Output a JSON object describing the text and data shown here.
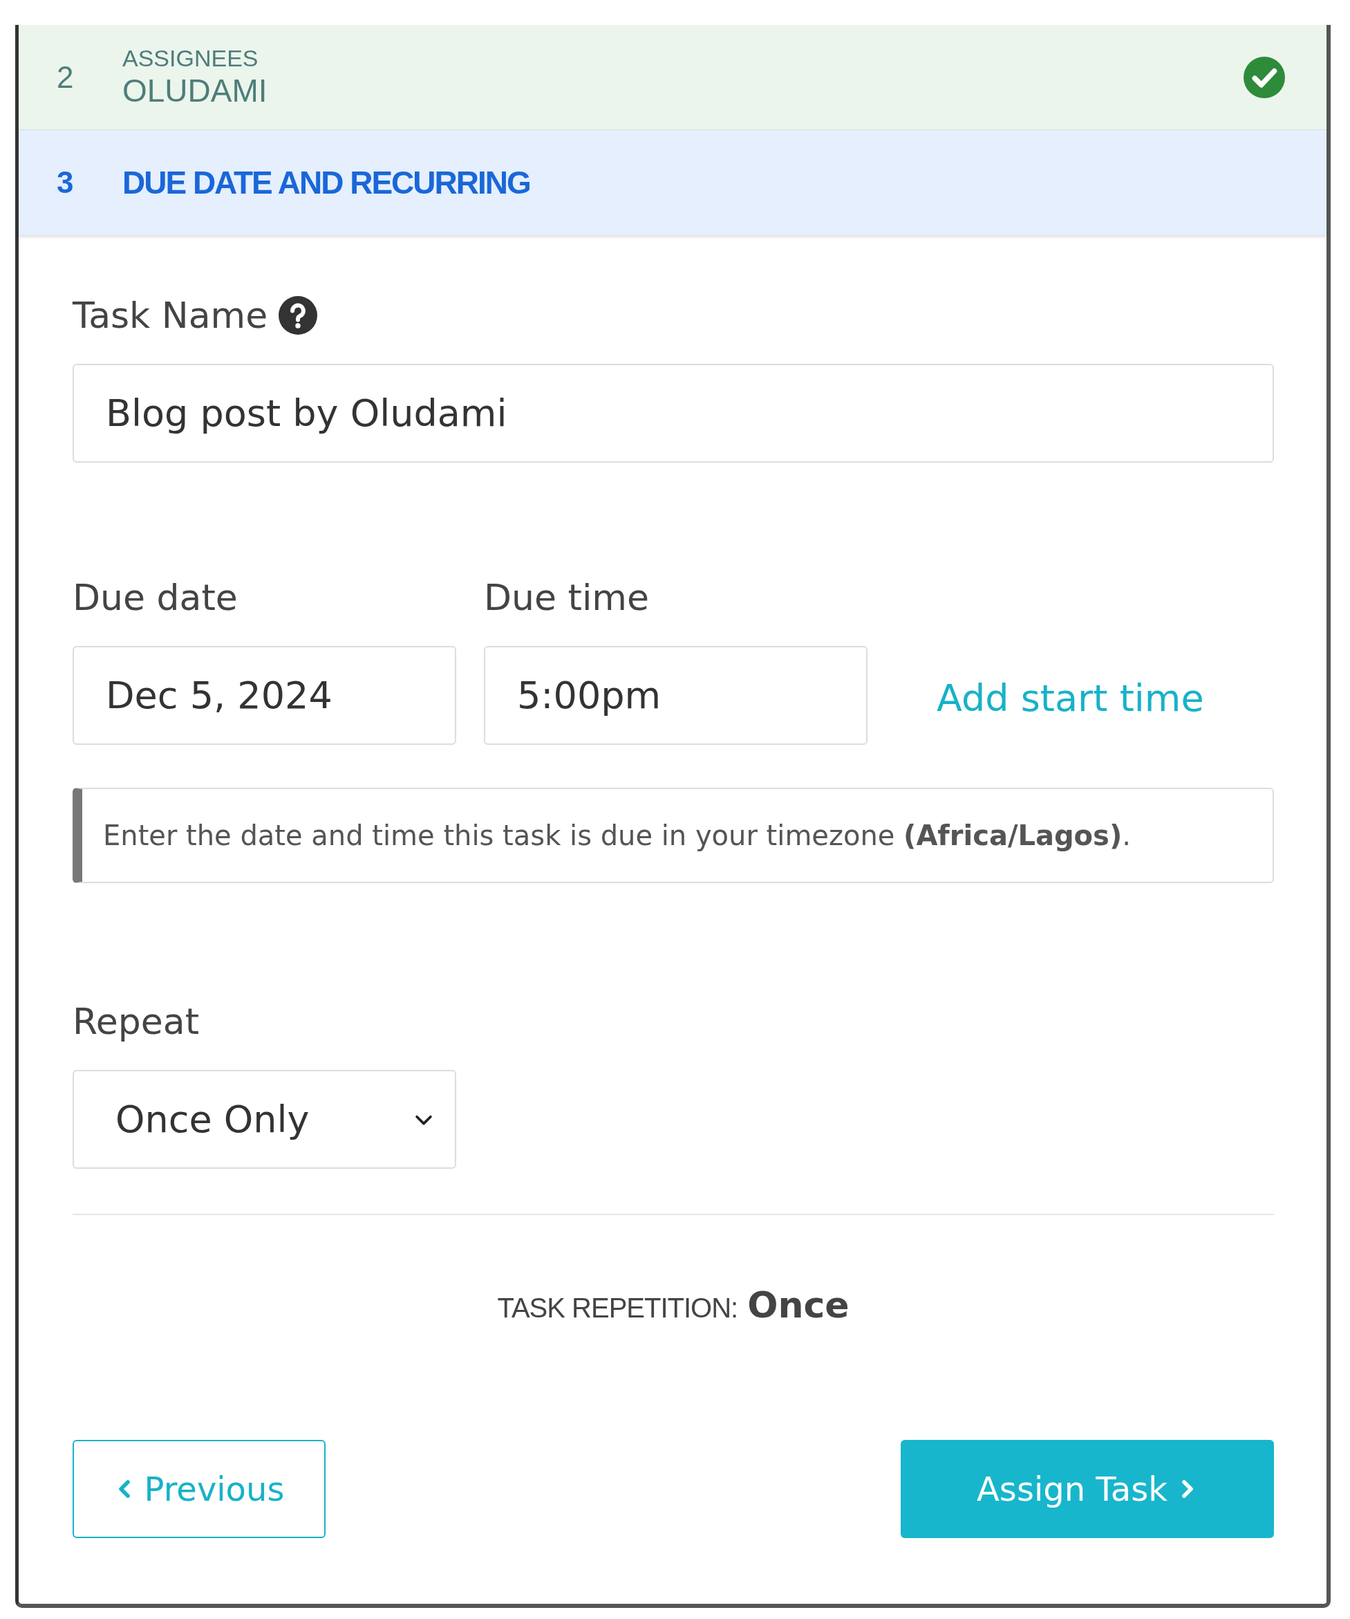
{
  "steps": [
    {
      "number": "2",
      "label": "ASSIGNEES",
      "value": "OLUDAMI",
      "completed": true,
      "selected": false
    },
    {
      "number": "3",
      "label": "DUE DATE AND RECURRING",
      "completed": false,
      "selected": true
    }
  ],
  "task_name": {
    "label": "Task Name",
    "value": "Blog post by Oludami"
  },
  "due_date": {
    "label": "Due date",
    "value": "Dec 5, 2024"
  },
  "due_time": {
    "label": "Due time",
    "value": "5:00pm"
  },
  "add_start_time_link": "Add start time",
  "note": "Enter the date and time this task is due in your timezone **(Africa/Lagos)**.",
  "repeat": {
    "label": "Repeat",
    "value": "Once Only"
  },
  "summary": {
    "label": "TASK REPETITION:",
    "value": "Once"
  },
  "buttons": [
    {
      "kind": "previous",
      "label": "Previous"
    },
    {
      "kind": "primary",
      "label": "Assign Task"
    }
  ]
}
